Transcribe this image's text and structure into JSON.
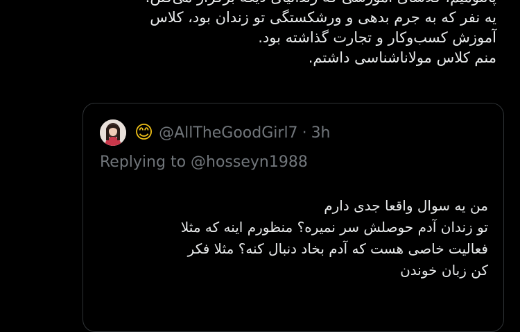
{
  "tweet": {
    "lines": [
      "پانتومیم، کلاسای آموزشی که زندانیای دیگه برگزار می‌کنن.",
      "یه نفر که به جرم بدهی و ورشکستگی تو زندان بود، کلاس",
      "آموزش کسب‌وکار و تجارت گذاشته بود.",
      "منم کلاس مولاناشناسی داشتم."
    ]
  },
  "quote": {
    "avatar_icon": "user-avatar-photo",
    "emoji": "😊",
    "handle": "@AllTheGoodGirl7",
    "separator": "·",
    "time": "3h",
    "replying_prefix": "Replying to",
    "replying_handle": "@hosseyn1988",
    "body_lines": [
      "من یه سوال واقعا جدی دارم",
      "تو زندان آدم حوصلش سر نمیره؟ منظورم اینه که مثلا",
      "فعالیت خاصی هست که آدم بخاد دنبال کنه؟ مثلا فکر",
      "کن زبان خوندن"
    ]
  },
  "colors": {
    "background": "#000000",
    "text": "#e7e9ea",
    "secondary": "#71767b",
    "border": "#2f3336"
  }
}
